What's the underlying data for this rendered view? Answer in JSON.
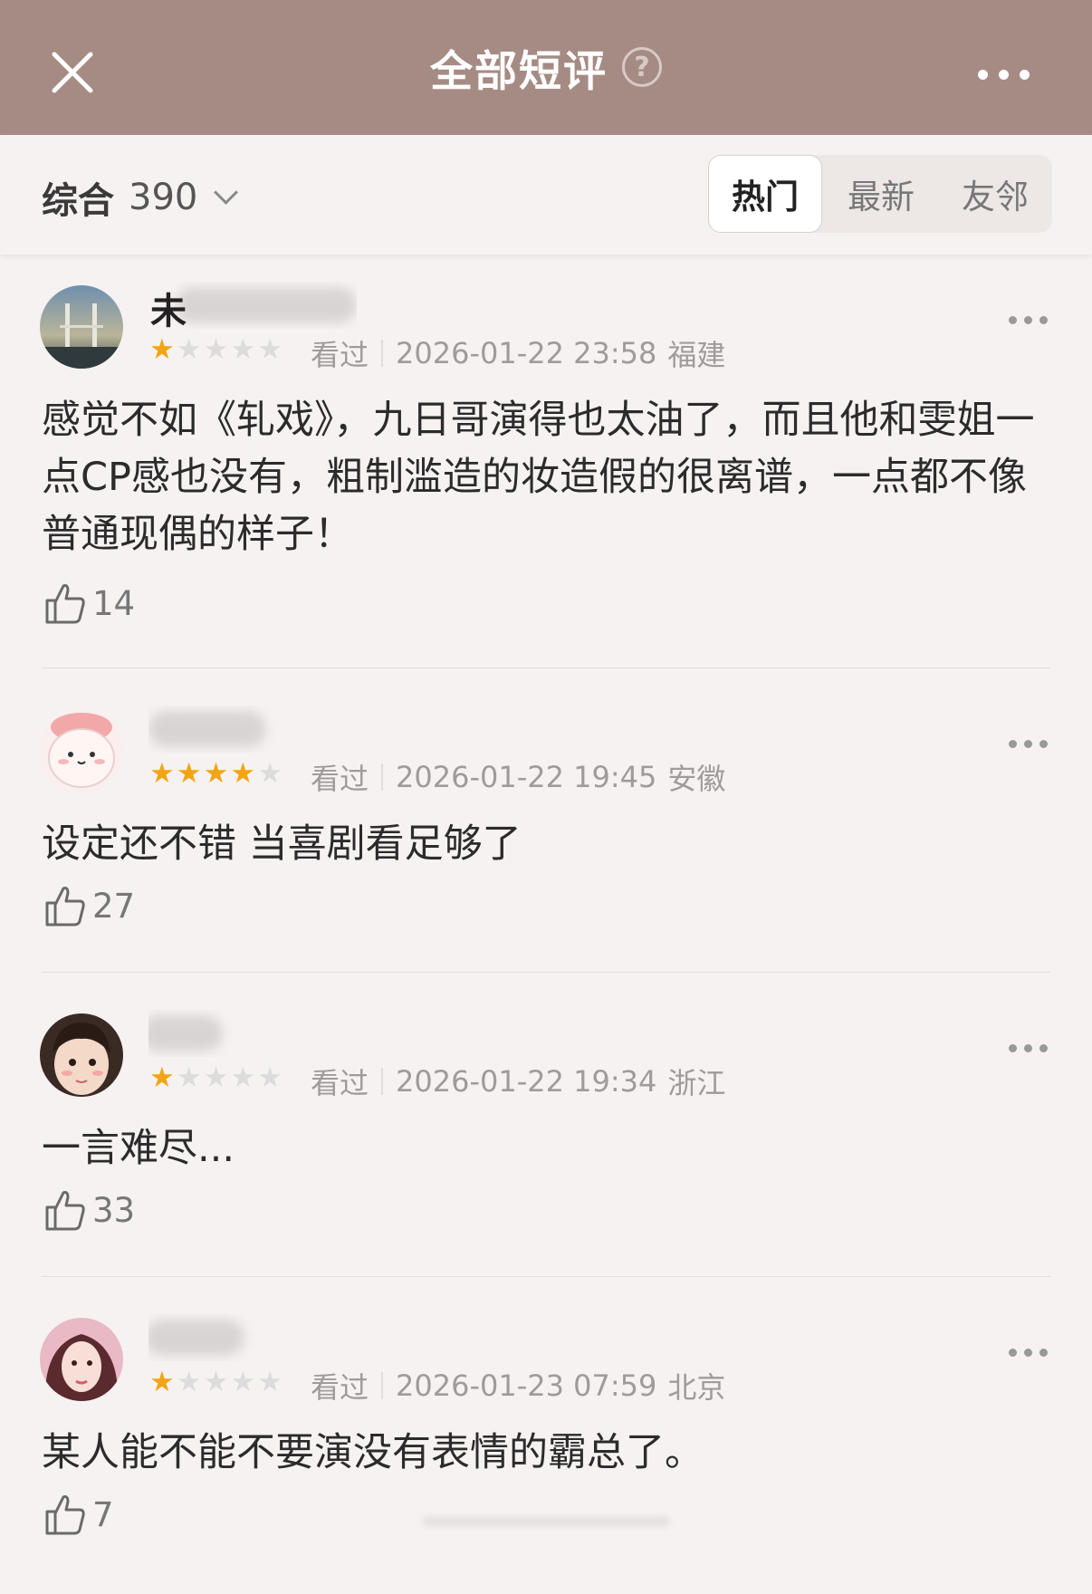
{
  "header": {
    "title": "全部短评",
    "help_glyph": "?",
    "close_icon": "close-icon",
    "more_icon": "more-icon"
  },
  "filter": {
    "sort_label": "综合",
    "count": "390",
    "tabs": [
      {
        "label": "热门",
        "active": true
      },
      {
        "label": "最新",
        "active": false
      },
      {
        "label": "友邻",
        "active": false
      }
    ]
  },
  "reviews": [
    {
      "username": "未",
      "rating": 1,
      "watched": "看过",
      "date": "2026-01-22 23:58",
      "location": "福建",
      "content": "感觉不如《轧戏》，九日哥演得也太油了，而且他和雯姐一点CP感也没有，粗制滥造的妆造假的很离谱，一点都不像普通现偶的样子！",
      "likes": "14"
    },
    {
      "username": "",
      "rating": 4,
      "watched": "看过",
      "date": "2026-01-22 19:45",
      "location": "安徽",
      "content": "设定还不错 当喜剧看足够了",
      "likes": "27"
    },
    {
      "username": "",
      "rating": 1,
      "watched": "看过",
      "date": "2026-01-22 19:34",
      "location": "浙江",
      "content": "一言难尽...",
      "likes": "33"
    },
    {
      "username": "",
      "rating": 1,
      "watched": "看过",
      "date": "2026-01-23 07:59",
      "location": "北京",
      "content": "某人能不能不要演没有表情的霸总了。",
      "likes": "7"
    }
  ],
  "colors": {
    "header_bg": "#a58b84",
    "star_on": "#f2a514",
    "star_off": "#dcdcdc"
  }
}
